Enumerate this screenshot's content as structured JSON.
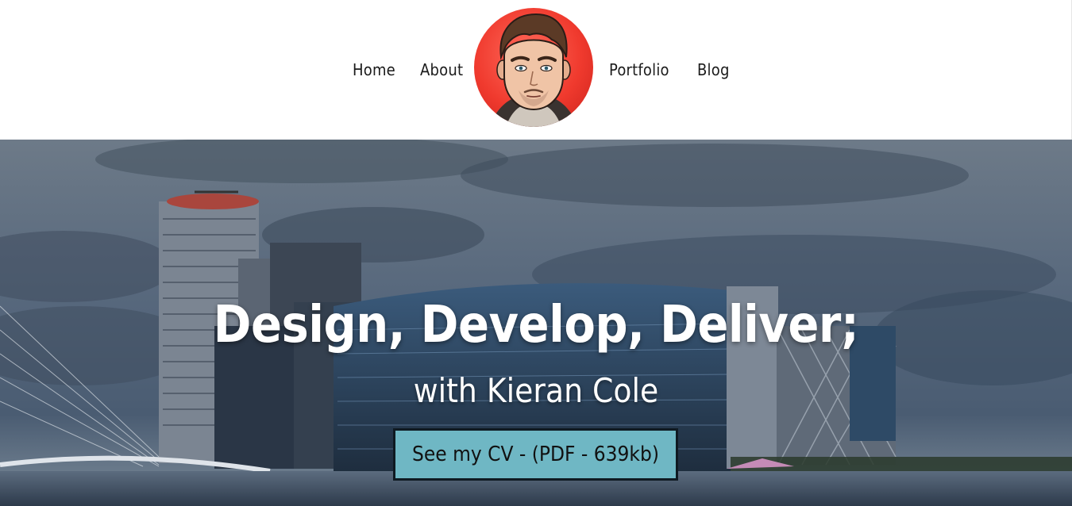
{
  "nav": {
    "items": [
      {
        "label": "Home"
      },
      {
        "label": "About"
      },
      {
        "label": "Portfolio"
      },
      {
        "label": "Blog"
      }
    ],
    "avatar_icon": "cartoon-portrait"
  },
  "hero": {
    "title": "Design, Develop, Deliver;",
    "subtitle": "with Kieran Cole",
    "cta_label": "See my CV - (PDF - 639kb)"
  },
  "colors": {
    "button_bg": "#6fb7c4",
    "button_border": "#0f1a22",
    "avatar_bg": "#f03a2e",
    "text_light": "#ffffff"
  }
}
